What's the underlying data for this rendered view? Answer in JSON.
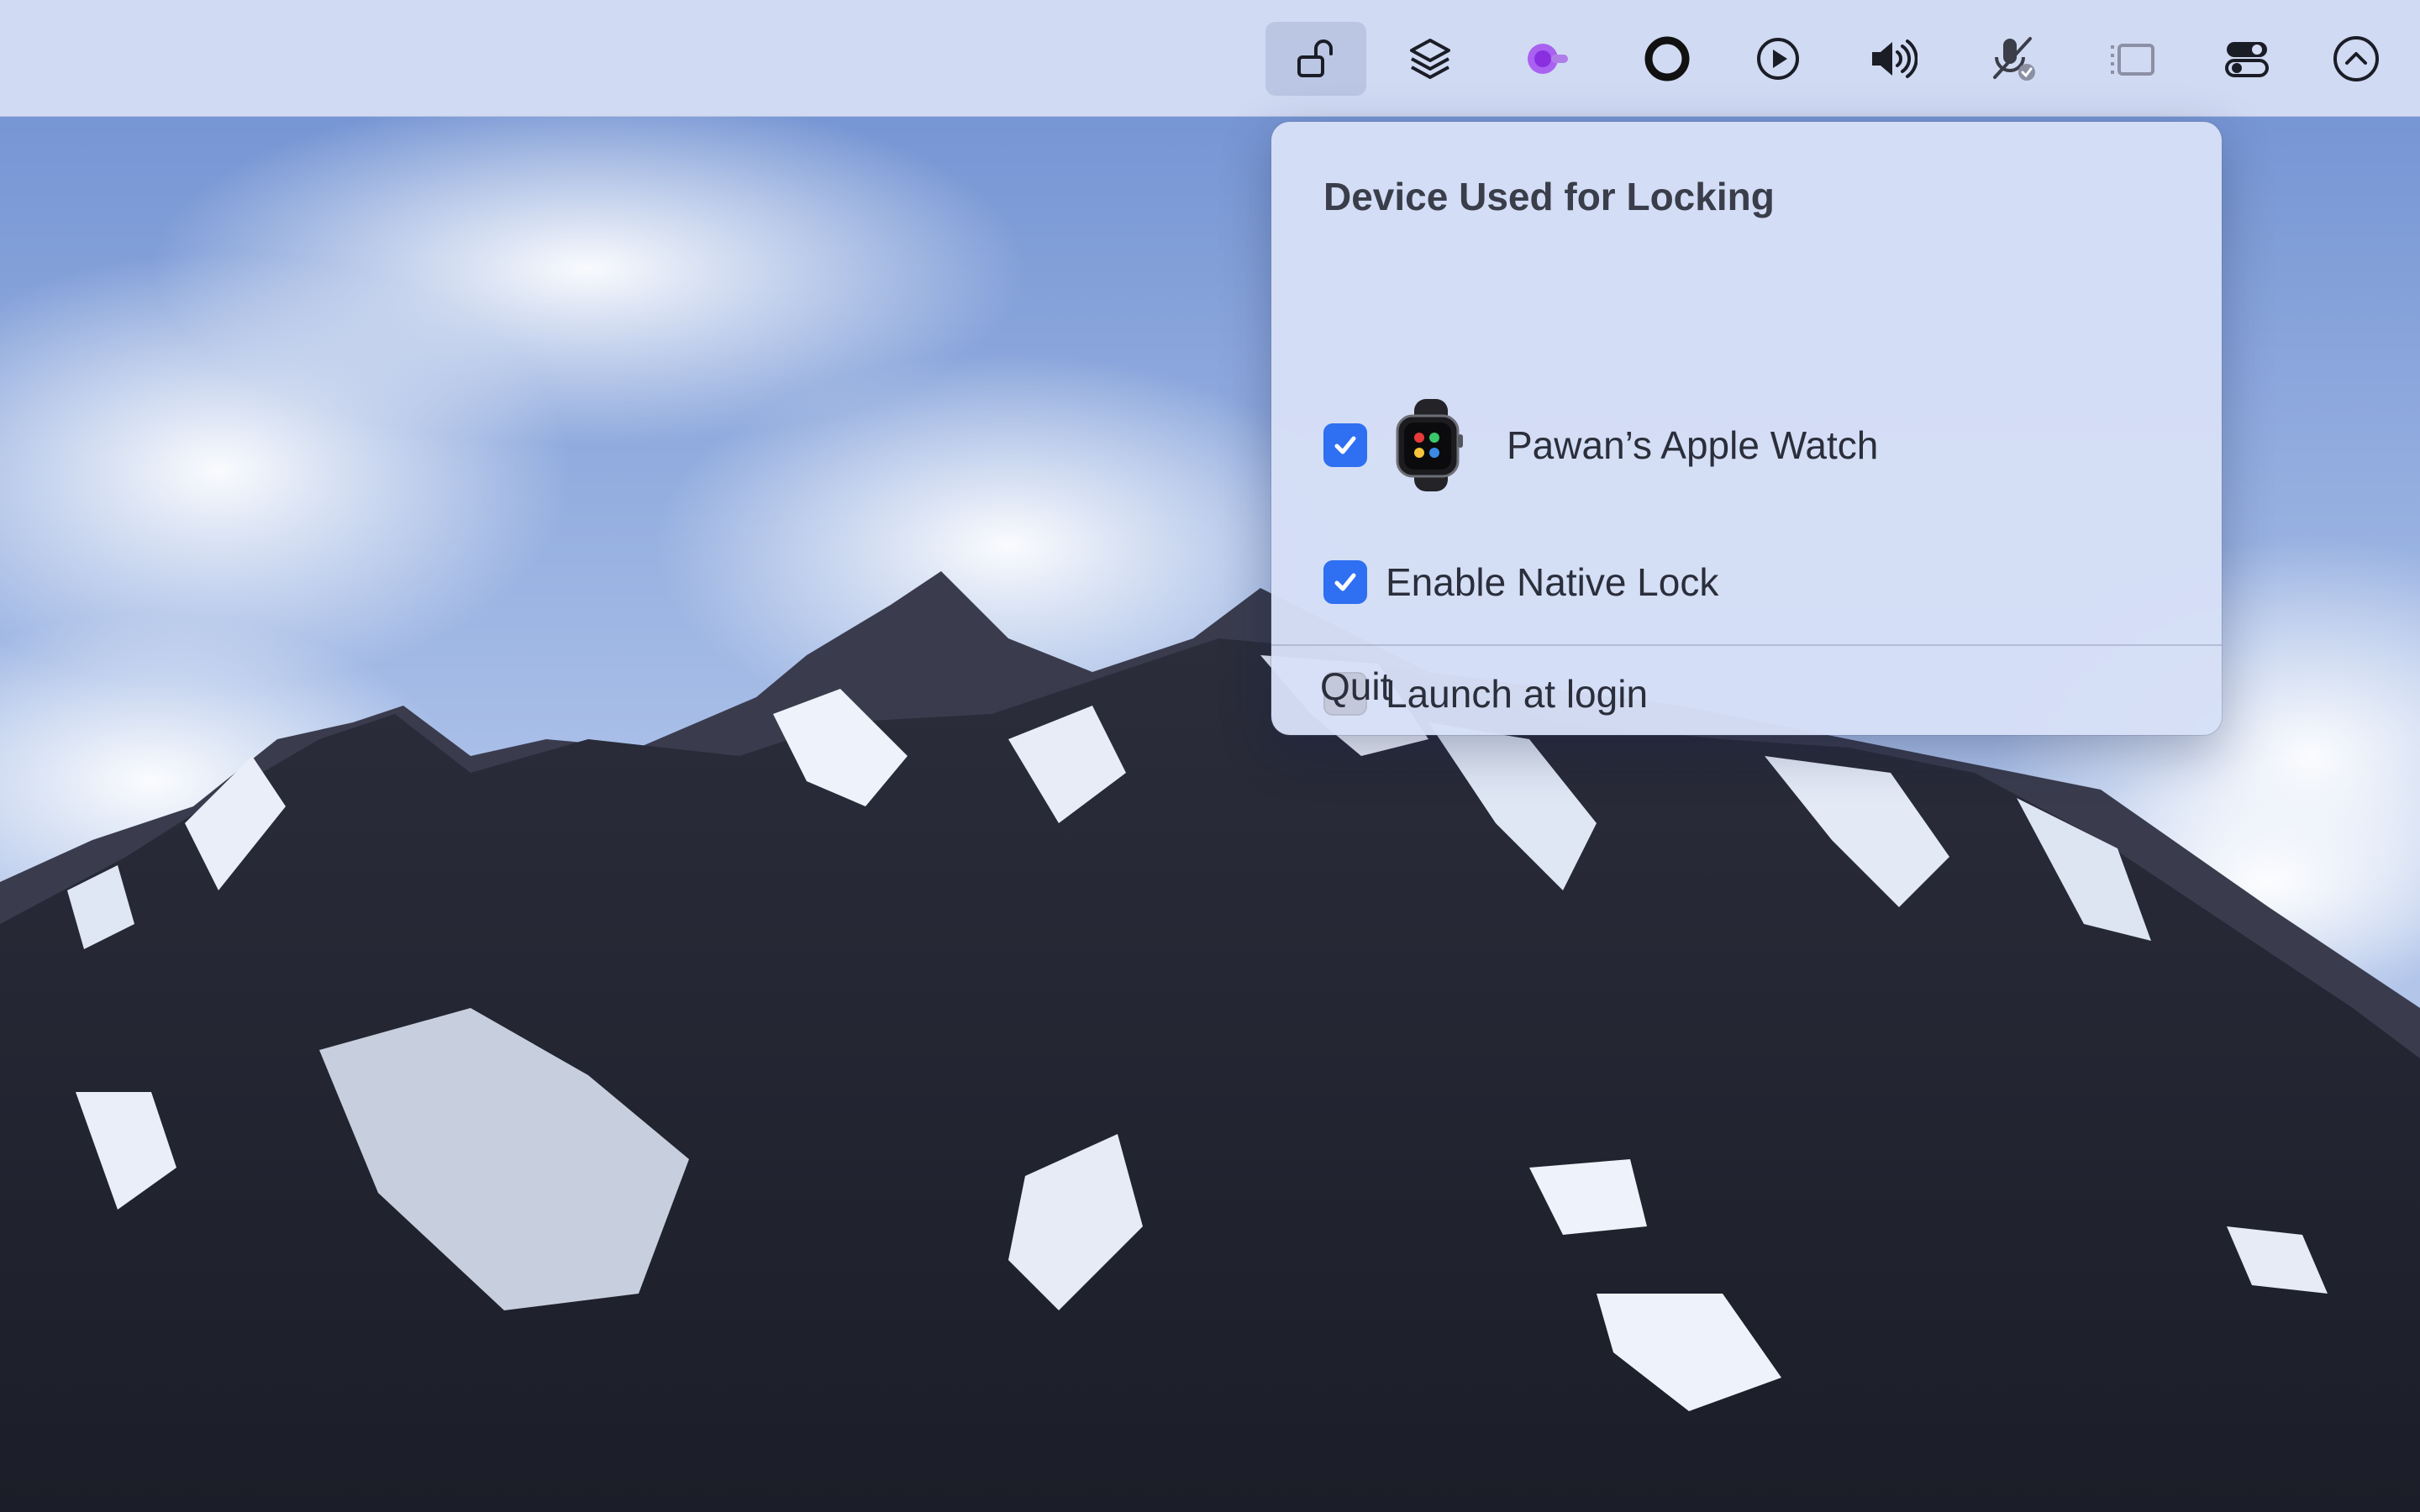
{
  "menubar": {
    "items": [
      {
        "icon": "lock-open-icon",
        "active": true
      },
      {
        "icon": "stack-icon"
      },
      {
        "icon": "app-dot-icon"
      },
      {
        "icon": "record-circle-icon"
      },
      {
        "icon": "play-icon"
      },
      {
        "icon": "speaker-icon"
      },
      {
        "icon": "microphone-off-icon"
      },
      {
        "icon": "sidebar-icon"
      },
      {
        "icon": "control-center-icon"
      },
      {
        "icon": "chevron-up-circle-icon"
      }
    ]
  },
  "menu": {
    "title": "Device Used for Locking",
    "device": {
      "label": "Pawan’s Apple Watch",
      "checked": true
    },
    "native_lock": {
      "label": "Enable Native Lock",
      "checked": true
    },
    "launch_at_login": {
      "label": "Launch at login",
      "checked": false
    },
    "quit_label": "Quit"
  },
  "colors": {
    "accent": "#2f6ff1",
    "app_dot": "#a24bf0"
  }
}
